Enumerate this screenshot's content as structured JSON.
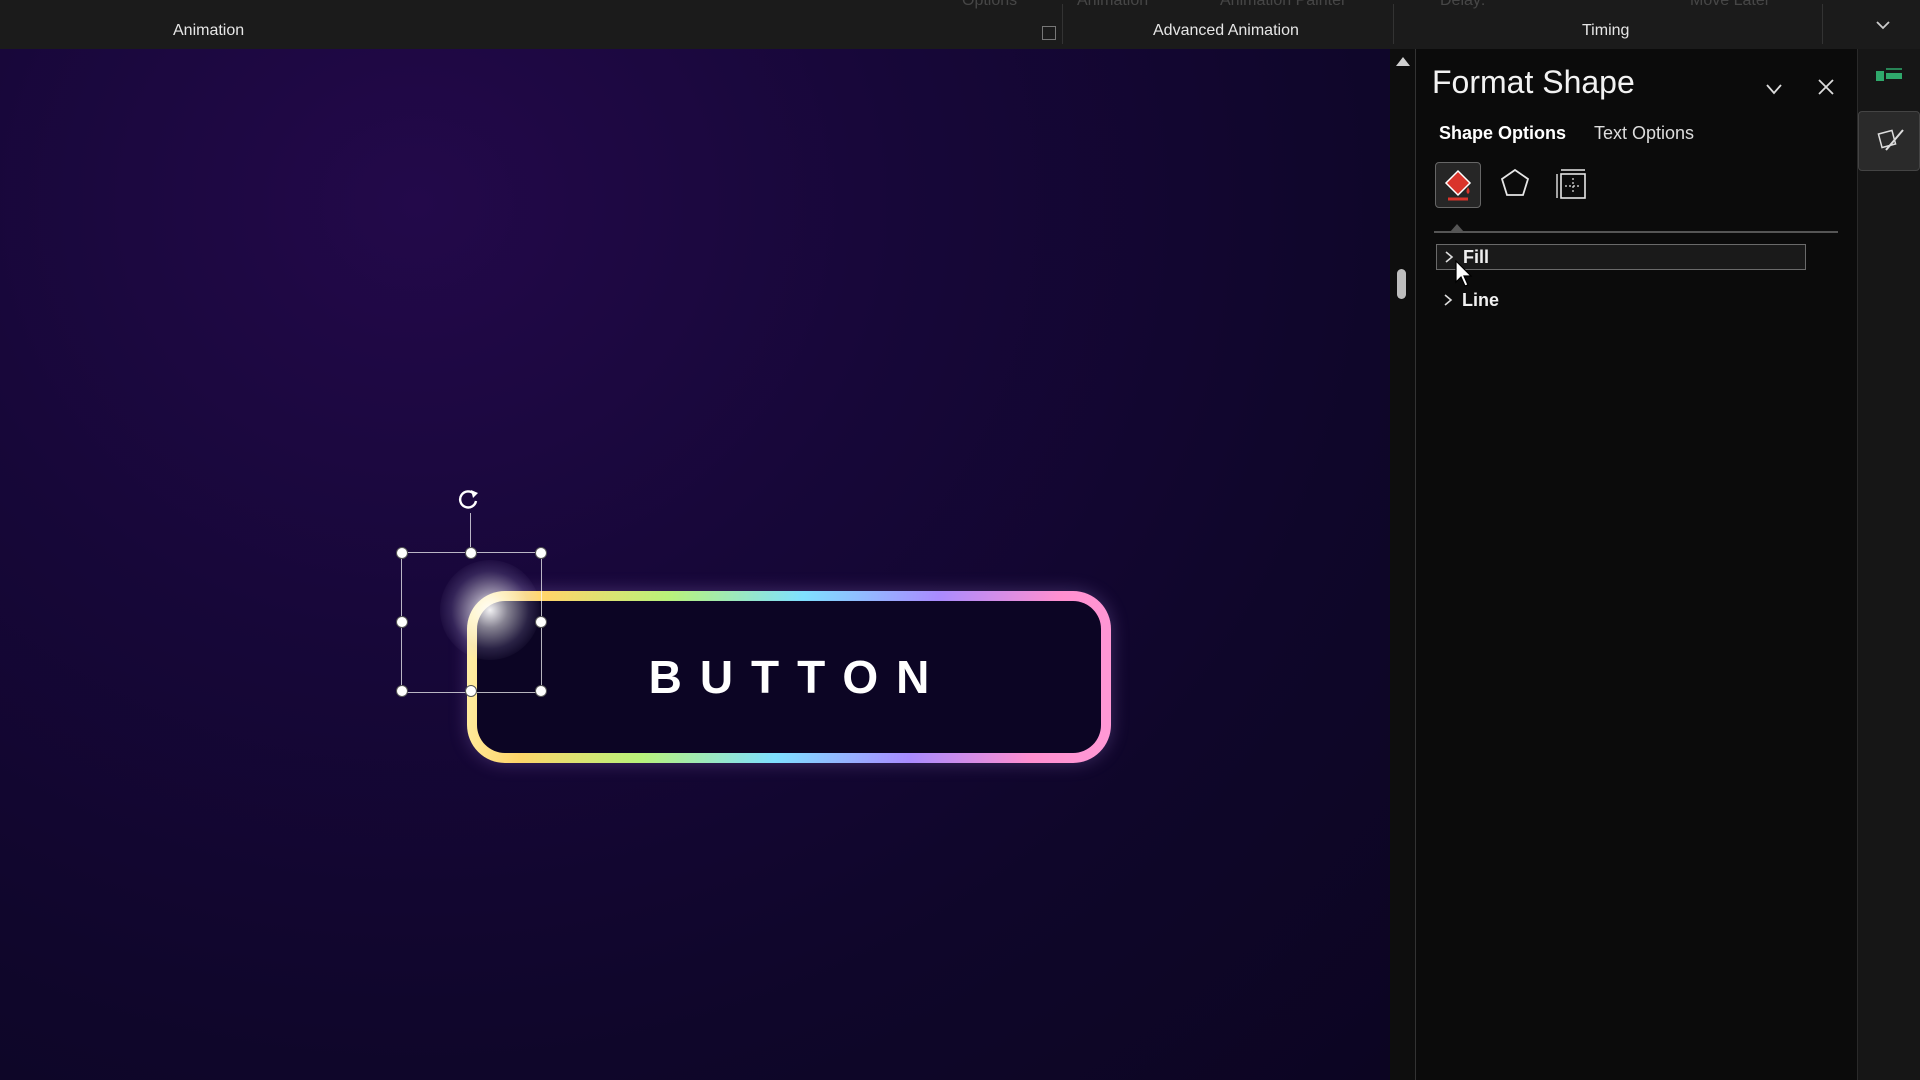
{
  "ribbon": {
    "groups": {
      "animation_label": "Animation",
      "advanced_animation_label": "Advanced Animation",
      "timing_label": "Timing"
    },
    "ghost_items": {
      "effect_options": "Options",
      "add_animation": "Animation",
      "animation_painter": "Animation Painter",
      "delay": "Delay:",
      "move_later": "Move Later"
    }
  },
  "slide": {
    "button_text": "BUTTON",
    "gradient_colors": [
      "#fff3b0",
      "#ffd56a",
      "#b9f27a",
      "#7fe0ff",
      "#a98bff",
      "#ff8fd0"
    ],
    "background_color": "#140634"
  },
  "format_pane": {
    "title": "Format Shape",
    "tabs": [
      {
        "label": "Shape Options",
        "active": true
      },
      {
        "label": "Text Options",
        "active": false
      }
    ],
    "icons": [
      "fill-line-icon",
      "effects-icon",
      "size-properties-icon"
    ],
    "sections": [
      {
        "label": "Fill",
        "expanded": false,
        "hover": true
      },
      {
        "label": "Line",
        "expanded": false,
        "hover": false
      }
    ]
  }
}
